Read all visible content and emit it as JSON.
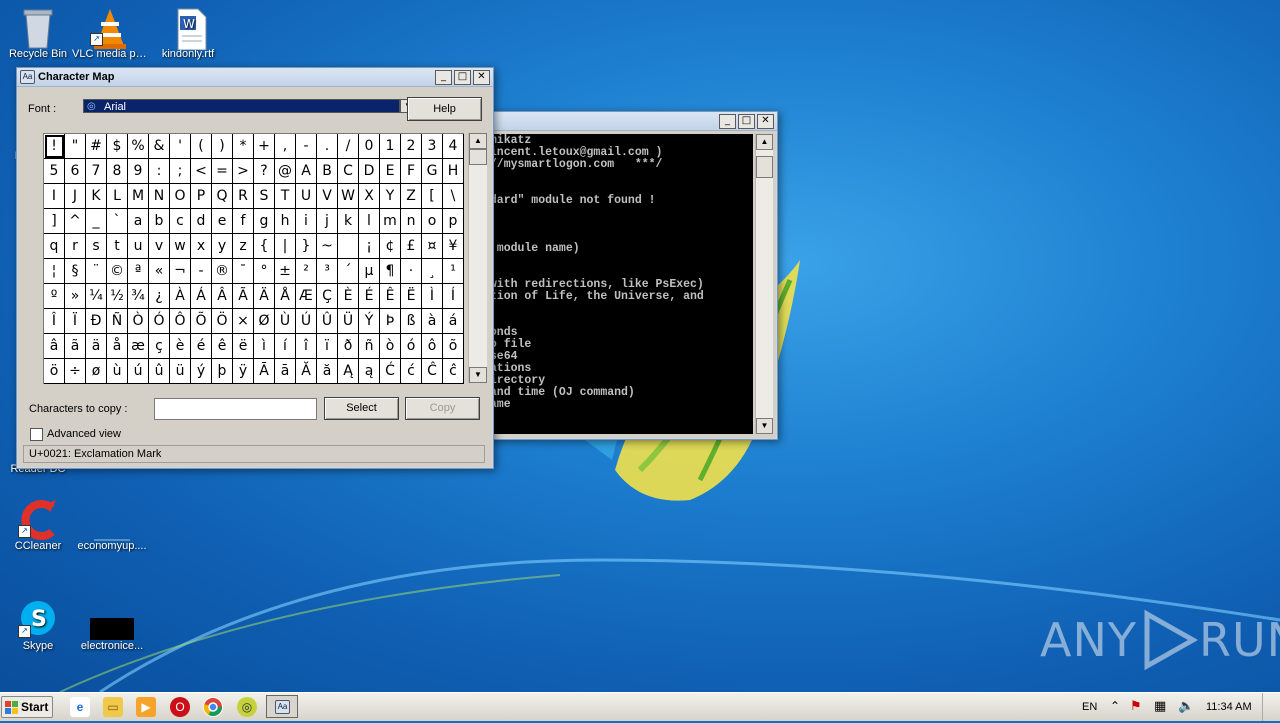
{
  "desktop": {
    "icons": [
      {
        "name": "recycle-bin",
        "label": "Recycle Bin",
        "shortcut": false
      },
      {
        "name": "vlc",
        "label": "VLC media player",
        "shortcut": true
      },
      {
        "name": "word-doc",
        "label": "kindonly.rtf",
        "shortcut": false
      },
      {
        "name": "adobe-reader",
        "label": "Acrobat Reader DC",
        "shortcut": true
      },
      {
        "name": "ccleaner",
        "label": "CCleaner",
        "shortcut": true
      },
      {
        "name": "economyup",
        "label": "economyup....",
        "shortcut": false
      },
      {
        "name": "skype",
        "label": "Skype",
        "shortcut": true
      },
      {
        "name": "electronice",
        "label": "electronice...",
        "shortcut": false
      }
    ],
    "partial_labels": {
      "left_mo": "Mo",
      "left_reader": "Reader DC"
    }
  },
  "charmap": {
    "title": "Character Map",
    "font_label": "Font :",
    "font_value": "Arial",
    "help_label": "Help",
    "chars": [
      "!",
      "\"",
      "#",
      "$",
      "%",
      "&",
      "'",
      "(",
      ")",
      "*",
      "+",
      ",",
      "-",
      ".",
      "/",
      "0",
      "1",
      "2",
      "3",
      "4",
      "5",
      "6",
      "7",
      "8",
      "9",
      ":",
      ";",
      "<",
      "=",
      ">",
      "?",
      "@",
      "A",
      "B",
      "C",
      "D",
      "E",
      "F",
      "G",
      "H",
      "I",
      "J",
      "K",
      "L",
      "M",
      "N",
      "O",
      "P",
      "Q",
      "R",
      "S",
      "T",
      "U",
      "V",
      "W",
      "X",
      "Y",
      "Z",
      "[",
      "\\",
      "]",
      "^",
      "_",
      "`",
      "a",
      "b",
      "c",
      "d",
      "e",
      "f",
      "g",
      "h",
      "i",
      "j",
      "k",
      "l",
      "m",
      "n",
      "o",
      "p",
      "q",
      "r",
      "s",
      "t",
      "u",
      "v",
      "w",
      "x",
      "y",
      "z",
      "{",
      "|",
      "}",
      "~",
      " ",
      "¡",
      "¢",
      "£",
      "¤",
      "¥",
      "¦",
      "§",
      "¨",
      "©",
      "ª",
      "«",
      "¬",
      "-",
      "®",
      "¯",
      "°",
      "±",
      "²",
      "³",
      "´",
      "µ",
      "¶",
      "·",
      "¸",
      "¹",
      "º",
      "»",
      "¼",
      "½",
      "¾",
      "¿",
      "À",
      "Á",
      "Â",
      "Ã",
      "Ä",
      "Å",
      "Æ",
      "Ç",
      "È",
      "É",
      "Ê",
      "Ë",
      "Ì",
      "Í",
      "Î",
      "Ï",
      "Ð",
      "Ñ",
      "Ò",
      "Ó",
      "Ô",
      "Õ",
      "Ö",
      "×",
      "Ø",
      "Ù",
      "Ú",
      "Û",
      "Ü",
      "Ý",
      "Þ",
      "ß",
      "à",
      "á",
      "â",
      "ã",
      "ä",
      "å",
      "æ",
      "ç",
      "è",
      "é",
      "ê",
      "ë",
      "ì",
      "í",
      "î",
      "ï",
      "ð",
      "ñ",
      "ò",
      "ó",
      "ô",
      "õ",
      "ö",
      "÷",
      "ø",
      "ù",
      "ú",
      "û",
      "ü",
      "ý",
      "þ",
      "ÿ",
      "Ā",
      "ā",
      "Ă",
      "ă",
      "Ą",
      "ą",
      "Ć",
      "ć",
      "Ĉ",
      "ĉ"
    ],
    "selected_index": 0,
    "copy_label": "Characters to copy :",
    "copy_value": "",
    "select_label": "Select",
    "copy_button_label": "Copy",
    "advanced_label": "Advanced view",
    "advanced_checked": false,
    "status": "U+0021: Exclamation Mark"
  },
  "console": {
    "lines": [
      "imikatz",
      "vincent.letoux@gmail.com )",
      "://mysmartlogon.com   ***/",
      "",
      "",
      "ndard\" module not found !",
      "",
      "",
      "",
      "e module name)",
      "",
      "",
      " with redirections, like PsExec)",
      "stion of Life, the Universe, and",
      "",
      "",
      "conds",
      "to file",
      "ase64",
      "mations",
      "directory",
      " and time (OJ command)",
      "name"
    ]
  },
  "watermark": {
    "left": "ANY",
    "right": "RUN"
  },
  "taskbar": {
    "start_label": "Start",
    "language": "EN",
    "clock": "11:34 AM"
  }
}
